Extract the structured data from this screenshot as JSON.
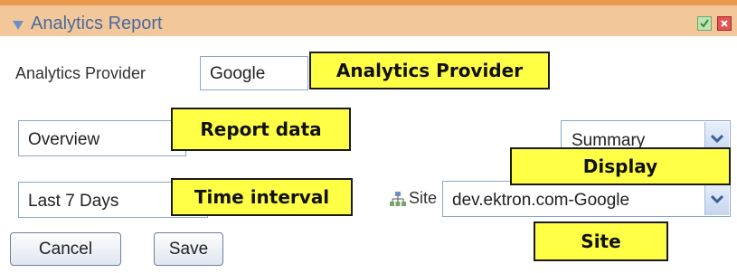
{
  "widget": {
    "title": "Analytics Report",
    "icons": [
      "collapse-arrow-icon",
      "checkbox-icon",
      "close-icon"
    ]
  },
  "provider": {
    "label": "Analytics Provider",
    "value": "Google"
  },
  "report": {
    "value": "Overview"
  },
  "display": {
    "value": "Summary"
  },
  "time": {
    "value": "Last 7 Days"
  },
  "site": {
    "label": "Site",
    "value": "dev.ektron.com-Google"
  },
  "buttons": {
    "cancel": "Cancel",
    "save": "Save"
  },
  "callouts": {
    "provider": "Analytics Provider",
    "report": "Report data",
    "display": "Display",
    "time": "Time interval",
    "site": "Site"
  },
  "colors": {
    "title_bar": "#f2c89b",
    "title_border": "#ea9a4e",
    "title_text": "#4a6b9e",
    "callout": "#ffff45",
    "field_border": "#8aa6c8"
  }
}
